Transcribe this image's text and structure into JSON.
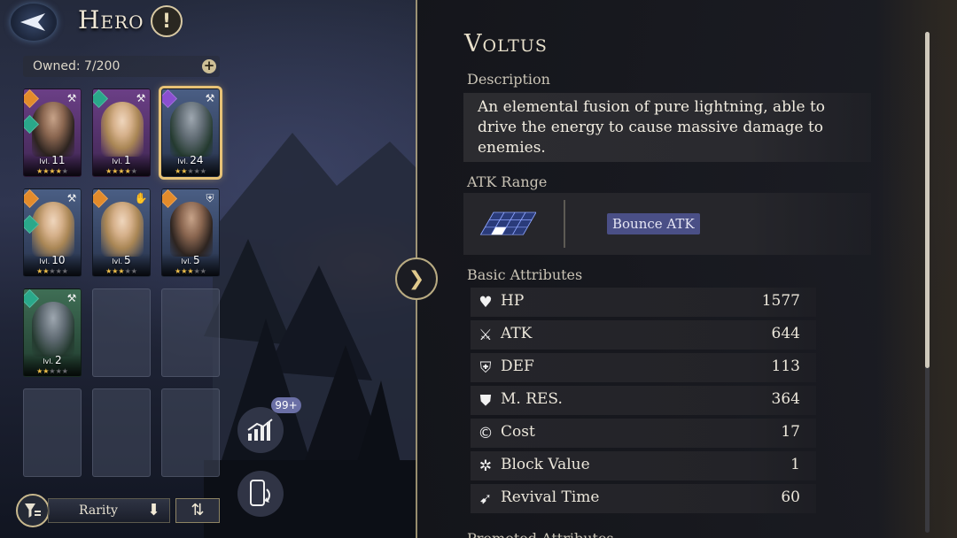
{
  "header": {
    "title": "Hero",
    "info_label": "!"
  },
  "roster": {
    "owned_label": "Owned: 7/200",
    "add_label": "+",
    "level_prefix": "lvl.",
    "cards": [
      {
        "level": "11",
        "stars": 4,
        "rarity": "purple",
        "element": "orange",
        "element2": "teal",
        "class_icon": "⚒",
        "portrait": "dark",
        "selected": false
      },
      {
        "level": "1",
        "stars": 4,
        "rarity": "purple",
        "element": "teal",
        "element2": "",
        "class_icon": "⚒",
        "portrait": "blonde",
        "selected": false
      },
      {
        "level": "24",
        "stars": 2,
        "rarity": "blue",
        "element": "purple",
        "element2": "",
        "class_icon": "⚒",
        "portrait": "armor",
        "selected": true
      },
      {
        "level": "10",
        "stars": 2,
        "rarity": "blue",
        "element": "orange",
        "element2": "teal",
        "class_icon": "⚒",
        "portrait": "blonde",
        "selected": false
      },
      {
        "level": "5",
        "stars": 3,
        "rarity": "blue",
        "element": "orange",
        "element2": "",
        "class_icon": "✋",
        "portrait": "blonde",
        "selected": false
      },
      {
        "level": "5",
        "stars": 3,
        "rarity": "blue",
        "element": "orange",
        "element2": "",
        "class_icon": "⛨",
        "portrait": "dark",
        "selected": false
      },
      {
        "level": "2",
        "stars": 2,
        "rarity": "green",
        "element": "teal",
        "element2": "",
        "class_icon": "⚒",
        "portrait": "armor",
        "selected": false
      }
    ]
  },
  "toolbar": {
    "sort_field": "Rarity",
    "sort_dir_arrow": "⬇",
    "sort_toggle": "⇅"
  },
  "side_actions": {
    "stats_badge": "99+"
  },
  "detail": {
    "collapse_label": "❯",
    "hero_name": "Voltus",
    "description_label": "Description",
    "description": "An elemental fusion of pure lightning, able to drive the energy to cause massive damage to enemies.",
    "atk_range_label": "ATK Range",
    "atk_type": "Bounce ATK",
    "basic_attributes_label": "Basic Attributes",
    "attributes": [
      {
        "icon": "heart-hand-icon",
        "glyph": "♥",
        "name": "HP",
        "value": "1577"
      },
      {
        "icon": "sword-icon",
        "glyph": "⚔",
        "name": "ATK",
        "value": "644"
      },
      {
        "icon": "shield-icon",
        "glyph": "⛨",
        "name": "DEF",
        "value": "113"
      },
      {
        "icon": "magic-shield-icon",
        "glyph": "⛊",
        "name": "M. RES.",
        "value": "364"
      },
      {
        "icon": "cost-icon",
        "glyph": "©",
        "name": "Cost",
        "value": "17"
      },
      {
        "icon": "block-icon",
        "glyph": "✲",
        "name": "Block Value",
        "value": "1"
      },
      {
        "icon": "revival-icon",
        "glyph": "➹",
        "name": "Revival Time",
        "value": "60"
      }
    ],
    "next_section_label": "Promoted Attributes"
  }
}
